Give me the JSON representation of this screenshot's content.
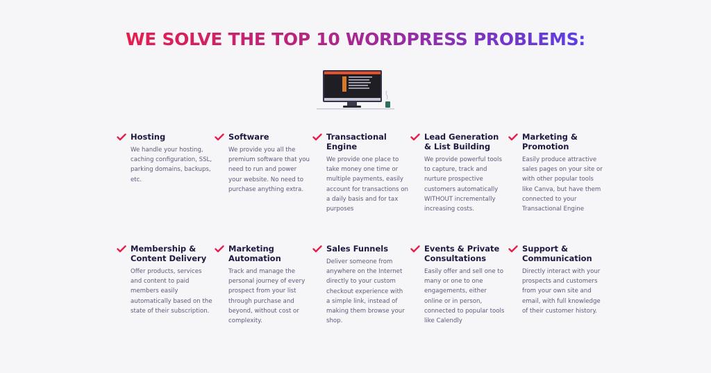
{
  "headline": "WE SOLVE THE TOP 10 WORDPRESS PROBLEMS:",
  "colors": {
    "accent": "#e61e4d",
    "gradient_mid": "#a8288f",
    "gradient_end": "#5a3ee6",
    "title": "#1c1a3f",
    "text": "#5a5a7a",
    "background": "#f6f6f9"
  },
  "illustration": {
    "icon": "monitor-with-coffee-icon"
  },
  "features": [
    {
      "icon": "check-icon",
      "title": "Hosting",
      "description": "We handle your hosting, caching configuration, SSL, parking domains, backups, etc."
    },
    {
      "icon": "check-icon",
      "title": "Software",
      "description": "We provide you all the premium software that you need to run and power your website. No need to purchase anything extra."
    },
    {
      "icon": "check-icon",
      "title": "Transactional Engine",
      "description": "We provide one place to take money one time or multiple payments, easily account for transactions on a daily basis and for tax purposes"
    },
    {
      "icon": "check-icon",
      "title": "Lead Generation & List Building",
      "description": "We provide powerful tools to capture, track and nurture prospective customers automatically WITHOUT incrementally increasing costs."
    },
    {
      "icon": "check-icon",
      "title": "Marketing & Promotion",
      "description": "Easily produce attractive sales pages on your site or with other popular tools like Canva, but have them connected to your Transactional Engine"
    },
    {
      "icon": "check-icon",
      "title": "Membership & Content Delivery",
      "description": "Offer products, services and content to paid members easily automatically based on the state of their subscription."
    },
    {
      "icon": "check-icon",
      "title": "Marketing Automation",
      "description": "Track and manage the personal journey of every prospect from your list through purchase and beyond, without cost or complexity."
    },
    {
      "icon": "check-icon",
      "title": "Sales Funnels",
      "description": "Deliver someone from anywhere on the Internet directly to your custom checkout experience with a simple link, instead of making them browse your shop."
    },
    {
      "icon": "check-icon",
      "title": "Events & Private Consultations",
      "description": "Easily offer and sell one to many or one to one engagements, either online or in person, connected to popular tools like Calendly"
    },
    {
      "icon": "check-icon",
      "title": "Support & Communication",
      "description": "Directly interact with your prospects and customers from your own site and email, with full knowledge of their customer history."
    }
  ]
}
